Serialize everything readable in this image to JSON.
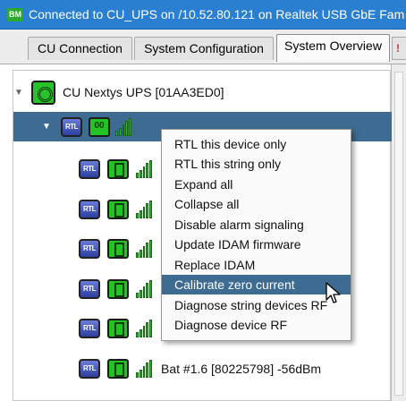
{
  "window": {
    "badge": "BM",
    "title": "Connected to CU_UPS on /10.52.80.121 on Realtek USB GbE Fam"
  },
  "tabs": [
    {
      "label": "CU Connection",
      "active": false
    },
    {
      "label": "System Configuration",
      "active": false
    },
    {
      "label": "System Overview",
      "active": true
    }
  ],
  "tab_overflow_label": "!",
  "tree": {
    "root_label": "CU Nextys UPS [01AA3ED0]",
    "string_icon_label": "00",
    "rtl_icon_label": "RTL",
    "battery_rows": [
      {
        "label": ""
      },
      {
        "label": ""
      },
      {
        "label": ""
      },
      {
        "label": ""
      },
      {
        "label": ""
      },
      {
        "label": "Bat #1.6 [80225798] -56dBm"
      }
    ]
  },
  "context_menu": {
    "items": [
      "RTL this device only",
      "RTL this string only",
      "Expand all",
      "Collapse all",
      "Disable alarm signaling",
      "Update IDAM firmware",
      "Replace IDAM",
      "Calibrate zero current",
      "Diagnose string devices RF",
      "Diagnose device RF"
    ],
    "highlighted_index": 7
  },
  "colors": {
    "titlebar": "#2a7fd0",
    "selection": "#3d6b91",
    "status_green": "#22c322",
    "rtl_blue": "#3b4fb8"
  }
}
